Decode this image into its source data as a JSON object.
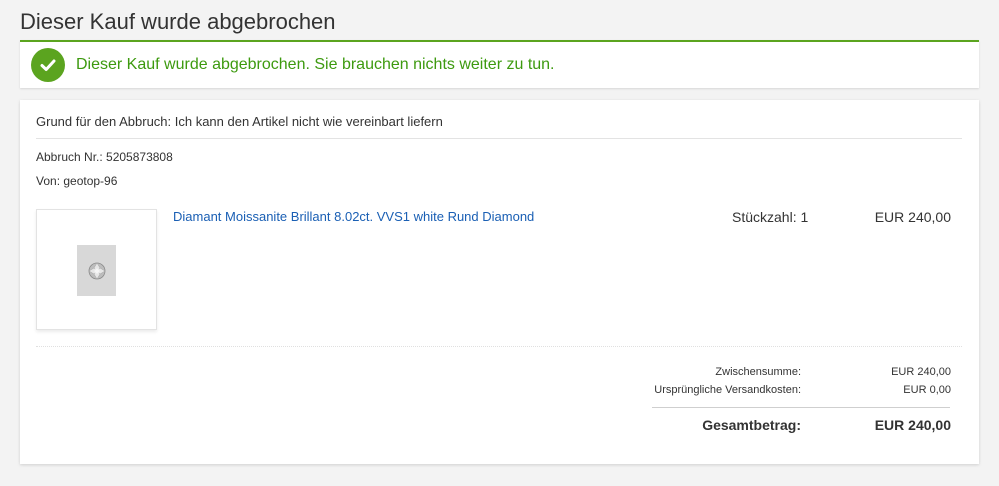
{
  "page": {
    "title": "Dieser Kauf wurde abgebrochen"
  },
  "banner": {
    "message": "Dieser Kauf wurde abgebrochen. Sie brauchen nichts weiter zu tun.",
    "icon": "check-icon",
    "color": "#5ba41f"
  },
  "details": {
    "reason": "Grund für den Abbruch: Ich kann den Artikel nicht wie vereinbart liefern",
    "cancel_number": "Abbruch Nr.: 5205873808",
    "from": "Von: geotop-96"
  },
  "item": {
    "title": "Diamant Moissanite Brillant 8.02ct. VVS1 white Rund Diamond",
    "quantity": "Stückzahl: 1",
    "price": "EUR 240,00",
    "link_color": "#1a5fb4"
  },
  "summary": {
    "subtotal_label": "Zwischensumme:",
    "subtotal_value": "EUR 240,00",
    "shipping_label": "Ursprüngliche Versandkosten:",
    "shipping_value": "EUR 0,00",
    "total_label": "Gesamtbetrag:",
    "total_value": "EUR 240,00"
  }
}
